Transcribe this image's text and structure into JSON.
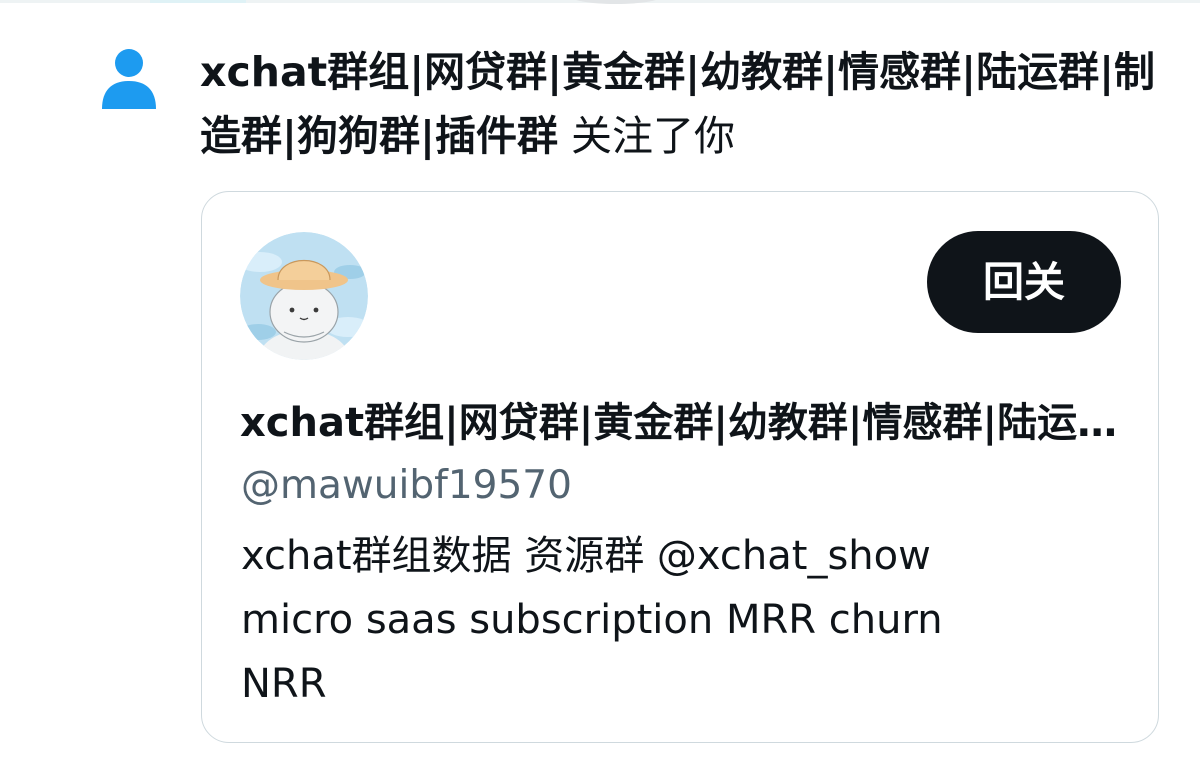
{
  "notification": {
    "icon": "person-icon",
    "actor_name": "xchat群组|网贷群|黄金群|幼教群|情感群|陆运群|制造群|狗狗群|插件群",
    "action_text": "关注了你"
  },
  "user_card": {
    "avatar": "cartoon-avatar-bucket-hat",
    "display_name": "xchat群组|网贷群|黄金群|幼教群|情感群|陆运群|制造群|狗狗群|插件群",
    "handle": "@mawuibf19570",
    "bio_lines": [
      "xchat群组数据 资源群 @xchat_show",
      "micro saas subscription MRR churn",
      "NRR"
    ],
    "follow_back_label": "回关"
  },
  "colors": {
    "person_icon": "#1d9bf0",
    "button_bg": "#0f1419",
    "button_text": "#ffffff",
    "secondary_text": "#536471",
    "card_border": "#cfd9de"
  }
}
